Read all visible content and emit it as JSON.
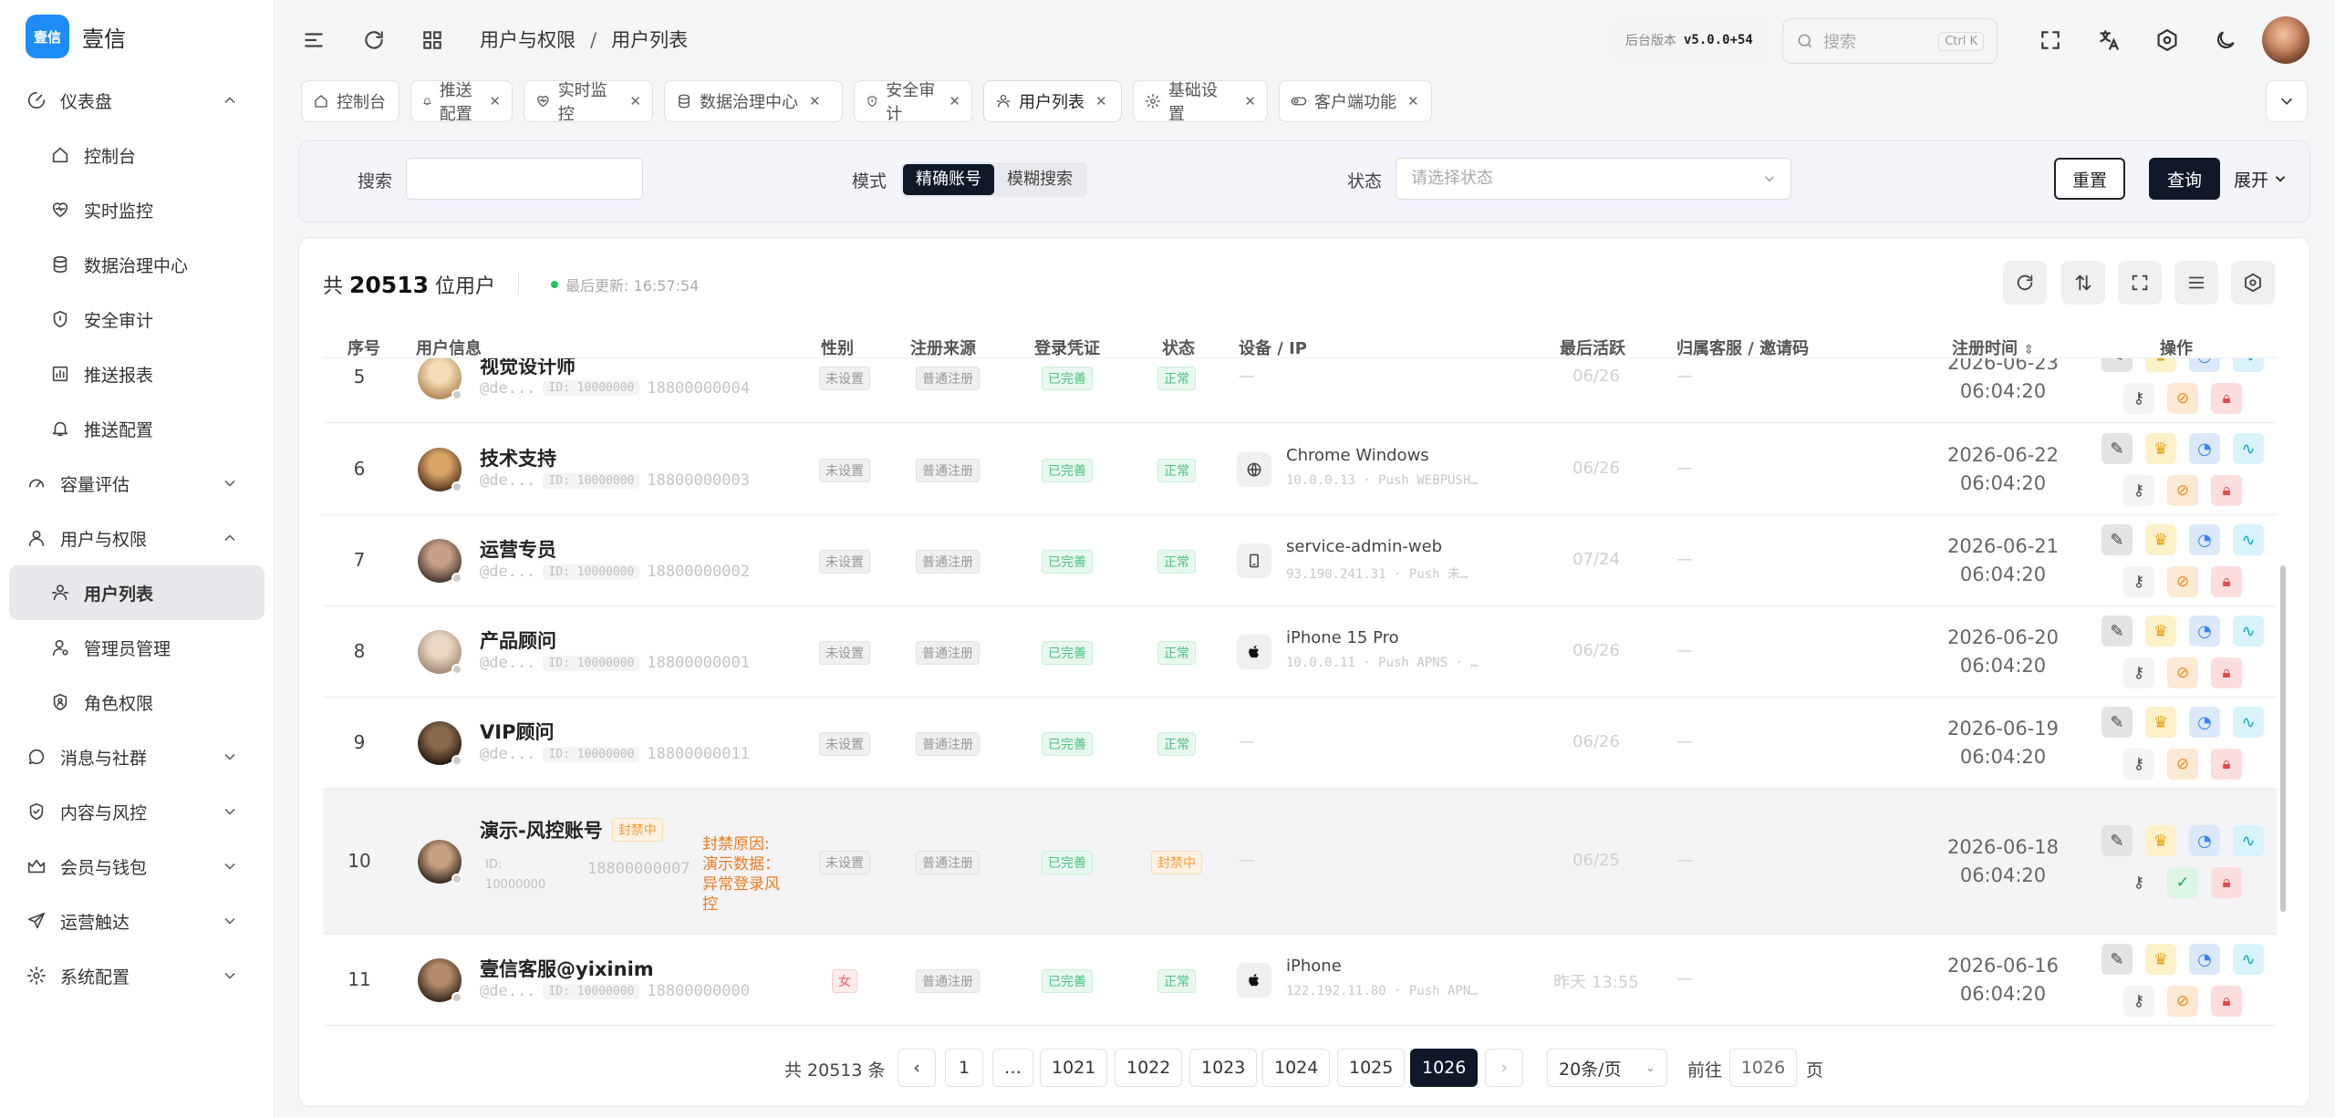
{
  "app": {
    "logo_mark": "壹信",
    "name": "壹信"
  },
  "sidebar": [
    {
      "type": "group",
      "label": "仪表盘",
      "icon": "dashboard-icon",
      "expanded": true
    },
    {
      "type": "sub",
      "label": "控制台",
      "icon": "home-icon"
    },
    {
      "type": "sub",
      "label": "实时监控",
      "icon": "heart-pulse-icon"
    },
    {
      "type": "sub",
      "label": "数据治理中心",
      "icon": "database-icon"
    },
    {
      "type": "sub",
      "label": "安全审计",
      "icon": "shield-icon"
    },
    {
      "type": "sub",
      "label": "推送报表",
      "icon": "bar-chart-icon"
    },
    {
      "type": "sub",
      "label": "推送配置",
      "icon": "bell-icon"
    },
    {
      "type": "group",
      "label": "容量评估",
      "icon": "gauge-icon",
      "expanded": false
    },
    {
      "type": "group",
      "label": "用户与权限",
      "icon": "user-icon",
      "expanded": true
    },
    {
      "type": "sub",
      "label": "用户列表",
      "icon": "users-icon",
      "active": true
    },
    {
      "type": "sub",
      "label": "管理员管理",
      "icon": "user-cog-icon"
    },
    {
      "type": "sub",
      "label": "角色权限",
      "icon": "shield-user-icon"
    },
    {
      "type": "group",
      "label": "消息与社群",
      "icon": "message-icon",
      "expanded": false
    },
    {
      "type": "group",
      "label": "内容与风控",
      "icon": "shield-check-icon",
      "expanded": false
    },
    {
      "type": "group",
      "label": "会员与钱包",
      "icon": "crown-icon",
      "expanded": false
    },
    {
      "type": "group",
      "label": "运营触达",
      "icon": "send-icon",
      "expanded": false
    },
    {
      "type": "group",
      "label": "系统配置",
      "icon": "gear-icon",
      "expanded": false
    }
  ],
  "header": {
    "breadcrumb": [
      "用户与权限",
      "用户列表"
    ],
    "version_label": "后台版本",
    "version": "v5.0.0+54",
    "search_placeholder": "搜索",
    "search_shortcut": "Ctrl K"
  },
  "tabs": [
    {
      "label": "控制台",
      "icon": "home-icon",
      "closable": false
    },
    {
      "label": "推送配置",
      "icon": "bell-icon",
      "closable": true
    },
    {
      "label": "实时监控",
      "icon": "heart-pulse-icon",
      "closable": true
    },
    {
      "label": "数据治理中心",
      "icon": "database-icon",
      "closable": true
    },
    {
      "label": "安全审计",
      "icon": "shield-icon",
      "closable": true
    },
    {
      "label": "用户列表",
      "icon": "users-icon",
      "closable": true,
      "active": true
    },
    {
      "label": "基础设置",
      "icon": "gear-icon",
      "closable": true
    },
    {
      "label": "客户端功能",
      "icon": "toggle-icon",
      "closable": true
    }
  ],
  "filter": {
    "search_label": "搜索",
    "search_value": "",
    "mode_label": "模式",
    "modes": [
      "精确账号",
      "模糊搜索"
    ],
    "mode_selected": "精确账号",
    "status_label": "状态",
    "status_placeholder": "请选择状态",
    "reset": "重置",
    "query": "查询",
    "expand": "展开"
  },
  "summary": {
    "prefix": "共",
    "count": "20513",
    "suffix": "位用户",
    "updated": "最后更新: 16:57:54"
  },
  "columns": [
    "序号",
    "用户信息",
    "性别",
    "注册来源",
    "登录凭证",
    "状态",
    "设备 / IP",
    "最后活跃",
    "归属客服 / 邀请码",
    "注册时间",
    "操作"
  ],
  "rows": [
    {
      "no": "5",
      "name": "视觉设计师",
      "handle": "@de...",
      "id": "ID: 10000000",
      "phone": "18800000004",
      "gender": "未设置",
      "gender_style": "gray",
      "source": "普通注册",
      "cred": "已完善",
      "status": "正常",
      "status_style": "green",
      "device_icon": "",
      "device": "",
      "ip": "",
      "last_active": "06/26",
      "agent": "—",
      "date": "2026-06-23",
      "time": "06:04:20",
      "avatar": [
        "#f3dcb6",
        "#b78a5c"
      ],
      "partial": true
    },
    {
      "no": "6",
      "name": "技术支持",
      "handle": "@de...",
      "id": "ID: 10000000",
      "phone": "18800000003",
      "gender": "未设置",
      "gender_style": "gray",
      "source": "普通注册",
      "cred": "已完善",
      "status": "正常",
      "status_style": "green",
      "device_icon": "globe-icon",
      "device": "Chrome Windows",
      "ip": "10.0.0.13 · Push WEBPUSH…",
      "last_active": "06/26",
      "agent": "—",
      "date": "2026-06-22",
      "time": "06:04:20",
      "avatar": [
        "#d9a366",
        "#5a3a22"
      ]
    },
    {
      "no": "7",
      "name": "运营专员",
      "handle": "@de...",
      "id": "ID: 10000000",
      "phone": "18800000002",
      "gender": "未设置",
      "gender_style": "gray",
      "source": "普通注册",
      "cred": "已完善",
      "status": "正常",
      "status_style": "green",
      "device_icon": "tablet-icon",
      "device": "service-admin-web",
      "ip": "93.190.241.31 · Push 未…",
      "last_active": "07/24",
      "agent": "—",
      "date": "2026-06-21",
      "time": "06:04:20",
      "avatar": [
        "#c8a089",
        "#4c3a30"
      ]
    },
    {
      "no": "8",
      "name": "产品顾问",
      "handle": "@de...",
      "id": "ID: 10000000",
      "phone": "18800000001",
      "gender": "未设置",
      "gender_style": "gray",
      "source": "普通注册",
      "cred": "已完善",
      "status": "正常",
      "status_style": "green",
      "device_icon": "apple-icon",
      "device": "iPhone 15 Pro",
      "ip": "10.0.0.11 · Push APNS · …",
      "last_active": "06/26",
      "agent": "—",
      "date": "2026-06-20",
      "time": "06:04:20",
      "avatar": [
        "#ead7c4",
        "#a58e7a"
      ]
    },
    {
      "no": "9",
      "name": "VIP顾问",
      "handle": "@de...",
      "id": "ID: 10000000",
      "phone": "18800000011",
      "gender": "未设置",
      "gender_style": "gray",
      "source": "普通注册",
      "cred": "已完善",
      "status": "正常",
      "status_style": "green",
      "device_icon": "",
      "device": "",
      "ip": "",
      "last_active": "06/26",
      "agent": "—",
      "date": "2026-06-19",
      "time": "06:04:20",
      "avatar": [
        "#8a6a4c",
        "#2a1c12"
      ]
    },
    {
      "no": "10",
      "name": "演示-风控账号",
      "badge": "封禁中",
      "handle": "",
      "id": "ID: 10000000",
      "phone": "18800000007",
      "ban_reason": "封禁原因: 演示数据：异常登录风控",
      "gender": "未设置",
      "gender_style": "gray",
      "source": "普通注册",
      "cred": "已完善",
      "status": "封禁中",
      "status_style": "orange",
      "device_icon": "",
      "device": "",
      "ip": "",
      "last_active": "06/25",
      "agent": "—",
      "date": "2026-06-18",
      "time": "06:04:20",
      "avatar": [
        "#c9a080",
        "#3a2c22"
      ],
      "highlight": true
    },
    {
      "no": "11",
      "name": "壹信客服@yixinim",
      "handle": "@de...",
      "id": "ID: 10000000",
      "phone": "18800000000",
      "gender": "女",
      "gender_style": "red",
      "source": "普通注册",
      "cred": "已完善",
      "status": "正常",
      "status_style": "green",
      "device_icon": "apple-icon",
      "device": "iPhone",
      "ip": "122.192.11.80 · Push APN…",
      "last_active": "昨天 13:55",
      "agent": "—",
      "date": "2026-06-16",
      "time": "06:04:20",
      "avatar": [
        "#b58a6a",
        "#3c2a1e"
      ]
    }
  ],
  "pagination": {
    "total": "共 20513 条",
    "pages": [
      "1",
      "…",
      "1021",
      "1022",
      "1023",
      "1024",
      "1025",
      "1026"
    ],
    "current": "1026",
    "page_size": "20条/页",
    "goto_label": "前往",
    "goto_value": "1026",
    "goto_suffix": "页"
  },
  "colors": {
    "brand": "#1e8cf7",
    "primary_dark": "#0f1729",
    "success": "#22c55e"
  }
}
